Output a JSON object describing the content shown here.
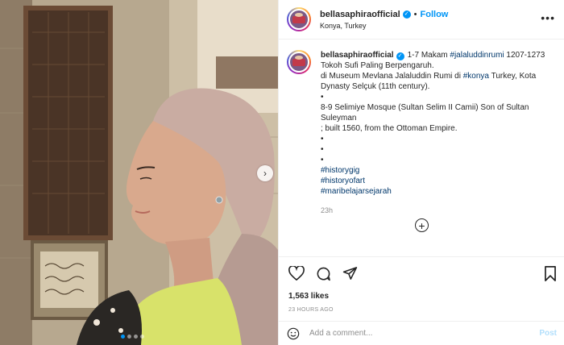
{
  "post": {
    "username": "bellasaphiraofficial",
    "follow_label": "Follow",
    "separator": "•",
    "location": "Konya, Turkey",
    "more_label": "•••"
  },
  "caption": {
    "username": "bellasaphiraofficial",
    "lines": [
      {
        "parts": [
          {
            "text": "1-7 Makam ",
            "tag": false
          },
          {
            "text": "#jalaluddinrumi",
            "tag": true
          },
          {
            "text": " 1207-1273",
            "tag": false
          }
        ]
      },
      {
        "parts": [
          {
            "text": "Tokoh Sufi Paling Berpengaruh.",
            "tag": false
          }
        ]
      },
      {
        "parts": [
          {
            "text": "di Museum Mevlana Jalaluddin Rumi di ",
            "tag": false
          },
          {
            "text": "#konya",
            "tag": true
          },
          {
            "text": " Turkey, Kota",
            "tag": false
          }
        ]
      },
      {
        "parts": [
          {
            "text": "Dynasty Selçuk (11th century).",
            "tag": false
          }
        ]
      },
      {
        "parts": [
          {
            "text": "•",
            "tag": false
          }
        ]
      },
      {
        "parts": [
          {
            "text": "8-9 Selimiye Mosque (Sultan Selim II Camii) Son of Sultan Suleyman",
            "tag": false
          }
        ]
      },
      {
        "parts": [
          {
            "text": "; built 1560, from the Ottoman Empire.",
            "tag": false
          }
        ]
      },
      {
        "parts": [
          {
            "text": "•",
            "tag": false
          }
        ]
      },
      {
        "parts": [
          {
            "text": "•",
            "tag": false
          }
        ]
      },
      {
        "parts": [
          {
            "text": "•",
            "tag": false
          }
        ]
      },
      {
        "parts": [
          {
            "text": "#historygig",
            "tag": true
          }
        ]
      },
      {
        "parts": [
          {
            "text": "#historyofart",
            "tag": true
          }
        ]
      },
      {
        "parts": [
          {
            "text": "#maribelajarsejarah",
            "tag": true
          }
        ]
      }
    ],
    "time": "23h"
  },
  "load_more_label": "+",
  "actions": {
    "icons": [
      "heart-icon",
      "comment-icon",
      "share-icon",
      "bookmark-icon"
    ]
  },
  "likes": "1,563 likes",
  "posted": "23 HOURS AGO",
  "comment_box": {
    "placeholder": "Add a comment...",
    "post_label": "Post"
  },
  "colors": {
    "link_blue": "#0095f6",
    "hashtag": "#00376b",
    "muted": "#8e8e8e",
    "post_disabled": "#b2dffc"
  }
}
